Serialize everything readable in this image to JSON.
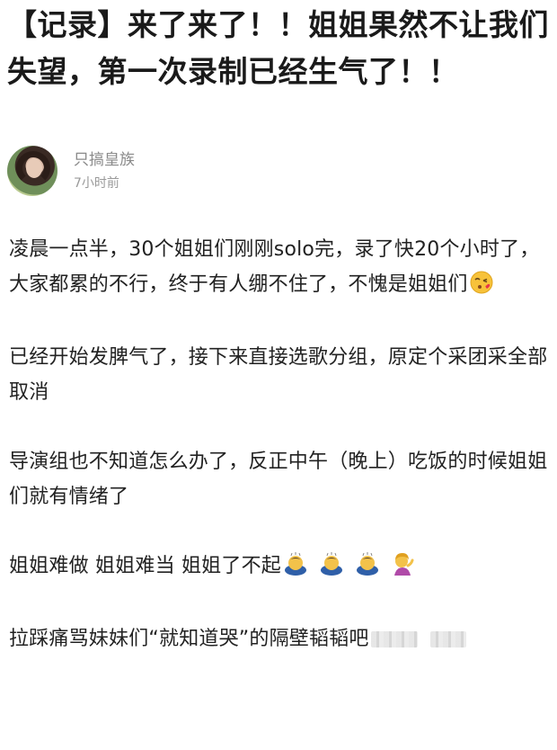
{
  "post": {
    "title": "【记录】来了来了！！姐姐果然不让我们失望，第一次录制已经生气了！！"
  },
  "author": {
    "name": "只搞皇族",
    "time": "7小时前"
  },
  "paragraphs": [
    "凌晨一点半，30个姐姐们刚刚solo完，录了快20个小时了，大家都累的不行，终于有人绷不住了，不愧是姐姐们",
    "已经开始发脾气了，接下来直接选歌分组，原定个采团采全部取消",
    "导演组也不知道怎么办了，反正中午（晚上）吃饭的时候姐姐们就有情绪了",
    "姐姐难做 姐姐难当 姐姐了不起",
    "拉踩痛骂妹妹们“就知道哭”的隔壁韬韬吧"
  ],
  "icons": {
    "kiss_emoji": "face-blowing-kiss-icon",
    "bow_emoji": "person-bowing-icon",
    "tipping_hand_emoji": "person-tipping-hand-icon",
    "avatar": "avatar"
  },
  "colors": {
    "title": "#1a1a1a",
    "body_text": "#222222",
    "meta_text": "#8a8a8a"
  }
}
